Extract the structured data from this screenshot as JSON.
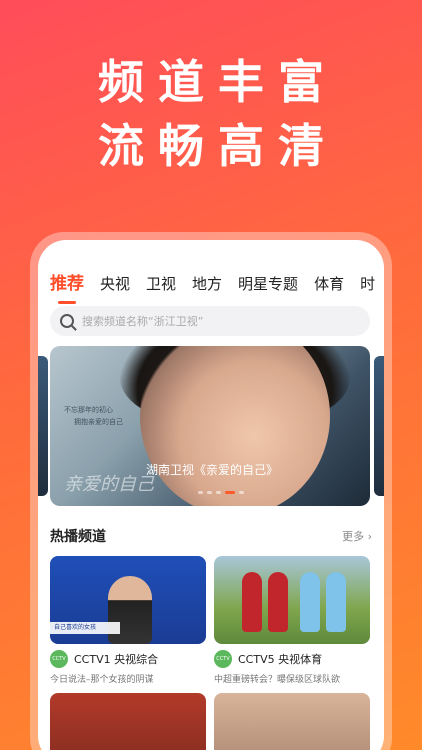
{
  "headline": {
    "line1": "频道丰富",
    "line2": "流畅高清"
  },
  "tabs": [
    "推荐",
    "央视",
    "卫视",
    "地方",
    "明星专题",
    "体育",
    "时"
  ],
  "search": {
    "placeholder": "搜索频道名称“浙江卫视”"
  },
  "banner": {
    "caption": "湖南卫视《亲爱的自己》",
    "overlay_small_text": [
      "不忘那年的初心",
      "拥抱亲爱的自己"
    ],
    "script_title": "亲爱的自己",
    "page_count": 5,
    "active_page": 4
  },
  "section": {
    "title": "热播频道",
    "more": "更多 ›"
  },
  "channels": [
    {
      "name": "CCTV1 央视综合",
      "program": "今日说法–那个女孩的阴谋",
      "logo": "CCTV",
      "ribbon": "自己喜欢的女孩"
    },
    {
      "name": "CCTV5 央视体育",
      "program": "中超重磅转会？曝保级区球队欲",
      "logo": "CCTV"
    },
    {
      "name": "",
      "program": ""
    },
    {
      "name": "",
      "program": ""
    }
  ],
  "colors": {
    "accent": "#ff4e2a",
    "gradient_start": "#ff4d5a",
    "gradient_end": "#ff8a2a"
  }
}
